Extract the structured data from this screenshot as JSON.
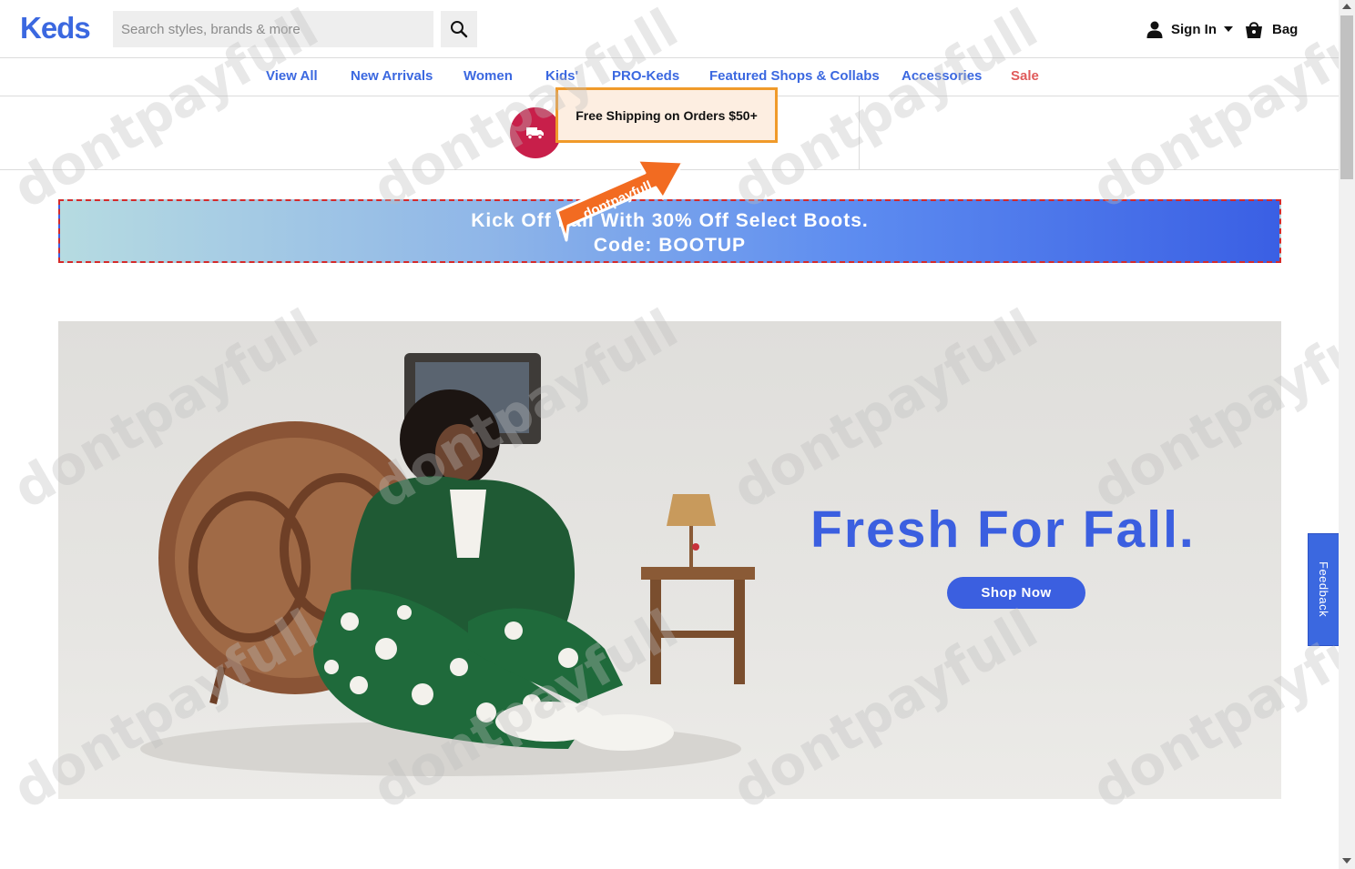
{
  "header": {
    "logo": "Keds",
    "search_placeholder": "Search styles, brands & more",
    "signin_label": "Sign In",
    "bag_label": "Bag"
  },
  "nav": {
    "items": [
      {
        "label": "View All"
      },
      {
        "label": "New Arrivals"
      },
      {
        "label": "Women"
      },
      {
        "label": "Kids'"
      },
      {
        "label": "PRO-Keds"
      },
      {
        "label": "Featured Shops & Collabs"
      },
      {
        "label": "Accessories"
      },
      {
        "label": "Sale"
      }
    ]
  },
  "promo": {
    "shipping_text": "Free Shipping on Orders $50+"
  },
  "banner": {
    "line1": "Kick Off Fall With 30% Off Select Boots.",
    "line2": "Code: BOOTUP"
  },
  "sticker": {
    "text": "dontpayfull"
  },
  "hero": {
    "title": "Fresh For Fall.",
    "button_label": "Shop Now"
  },
  "feedback": {
    "label": "Feedback"
  },
  "watermark": {
    "text": "dontpayfull"
  },
  "colors": {
    "brand_blue": "#3b68e0",
    "sale_red": "#e05a5a",
    "highlight_orange": "#f09a2a",
    "truck_circle": "#c81f4a"
  }
}
